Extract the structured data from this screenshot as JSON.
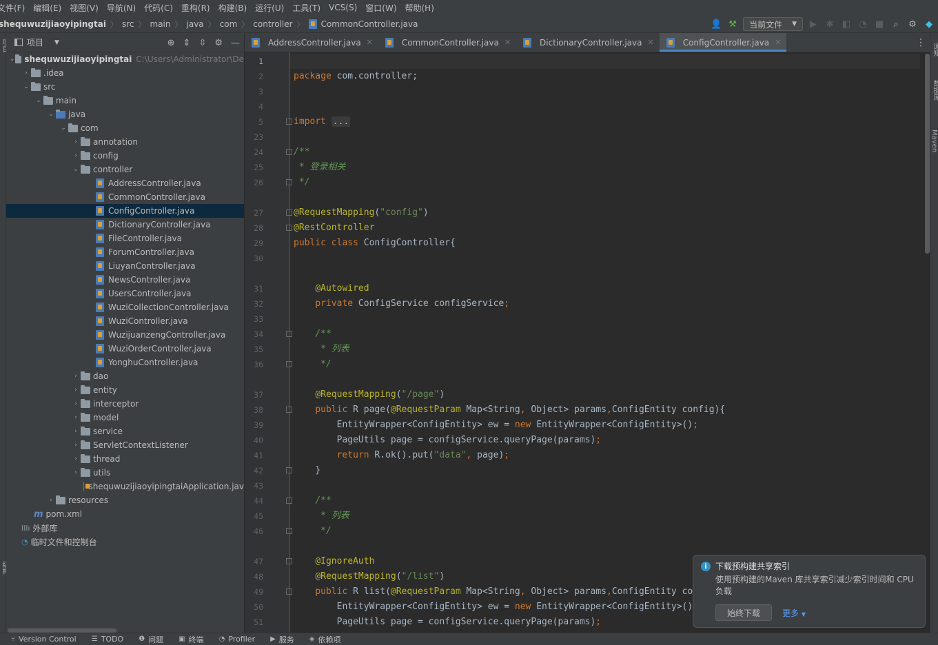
{
  "menu": [
    "文件(F)",
    "编辑(E)",
    "视图(V)",
    "导航(N)",
    "代码(C)",
    "重构(R)",
    "构建(B)",
    "运行(U)",
    "工具(T)",
    "VCS(S)",
    "窗口(W)",
    "帮助(H)"
  ],
  "breadcrumb": {
    "project": "shequwuzijiaoyipingtai",
    "parts": [
      "src",
      "main",
      "java",
      "com",
      "controller"
    ],
    "file": "CommonController.java"
  },
  "toolbar": {
    "run_config": "当前文件",
    "icons": [
      "user-icon",
      "hammer-icon",
      "run-icon",
      "debug-icon",
      "coverage-icon",
      "profile-icon",
      "stop-icon",
      "search-icon",
      "gear-icon"
    ]
  },
  "project_panel": {
    "title": "项目",
    "root_label": "shequwuzijiaoyipingtai",
    "root_path": "C:\\Users\\Administrator\\De",
    "tree": {
      "idea": ".idea",
      "src": "src",
      "main": "main",
      "java": "java",
      "com": "com",
      "annotation": "annotation",
      "config": "config",
      "controller": "controller",
      "files": [
        "AddressController.java",
        "CommonController.java",
        "ConfigController.java",
        "DictionaryController.java",
        "FileController.java",
        "ForumController.java",
        "LiuyanController.java",
        "NewsController.java",
        "UsersController.java",
        "WuziCollectionController.java",
        "WuziController.java",
        "WuzijuanzengController.java",
        "WuziOrderController.java",
        "YonghuController.java"
      ],
      "after_controller": [
        "dao",
        "entity",
        "interceptor",
        "model",
        "service",
        "ServletContextListener",
        "thread",
        "utils"
      ],
      "app_file": "shequwuzijiaoyipingtaiApplication.jav",
      "resources": "resources",
      "pom": "pom.xml",
      "external_libs": "外部库",
      "scratches": "临时文件和控制台"
    }
  },
  "tabs": [
    {
      "label": "AddressController.java",
      "active": false
    },
    {
      "label": "CommonController.java",
      "active": false
    },
    {
      "label": "DictionaryController.java",
      "active": false
    },
    {
      "label": "ConfigController.java",
      "active": true
    }
  ],
  "editor": {
    "line_numbers": [
      "1",
      "2",
      "3",
      "4",
      "5",
      "23",
      "24",
      "25",
      "26",
      "27",
      "28",
      "29",
      "30",
      "31",
      "32",
      "33",
      "34",
      "35",
      "36",
      "37",
      "38",
      "39",
      "40",
      "41",
      "42",
      "43",
      "44",
      "45",
      "46",
      "47",
      "48",
      "49",
      "50",
      "51"
    ]
  },
  "notification": {
    "title": "下载预构建共享索引",
    "body": "使用预构建的Maven 库共享索引减少索引时间和 CPU 负载",
    "button": "始终下载",
    "more": "更多"
  },
  "statusbar": [
    "Version Control",
    "TODO",
    "问题",
    "终端",
    "Profiler",
    "服务",
    "依赖项"
  ],
  "side_tabs": {
    "left_top": "项目",
    "left_bottom": "结构",
    "right": [
      "通知",
      "数据库",
      "Maven"
    ]
  },
  "colors": {
    "keyword": "#cc7832",
    "string": "#6a8759",
    "annotation": "#bbb529",
    "comment": "#629755",
    "accent": "#4a88c7"
  }
}
